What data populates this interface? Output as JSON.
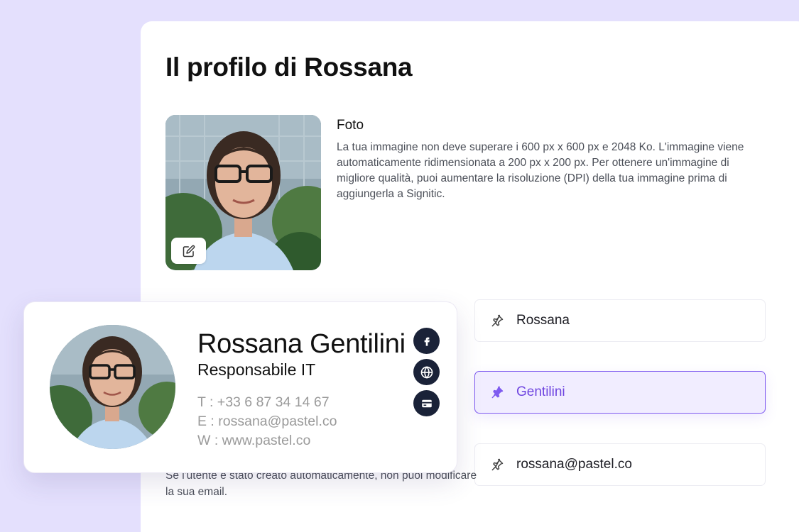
{
  "page": {
    "title": "Il profilo di Rossana"
  },
  "photo_section": {
    "label": "Foto",
    "description": "La tua immagine non deve superare i 600 px x 600 px e 2048 Ko. L'immagine viene automaticamente ridimensionata a 200 px x 200 px. Per ottenere un'immagine di migliore qualità, puoi aumentare la risoluzione (DPI) della tua immagine prima di aggiungerla a Signitic.",
    "edit_icon": "pencil-icon"
  },
  "fields": {
    "first_name": "Rossana",
    "last_name": "Gentilini",
    "email": "rossana@pastel.co",
    "icon": "pin-icon"
  },
  "email_note": "Se l'utente è stato creato automaticamente, non puoi modificare la sua email.",
  "signature": {
    "name": "Rossana Gentilini",
    "role": "Responsabile IT",
    "phone": "T : +33 6 87 34 14 67",
    "email": "E : rossana@pastel.co",
    "website": "W : www.pastel.co",
    "social_icons": [
      "facebook-icon",
      "globe-icon",
      "card-icon"
    ]
  },
  "colors": {
    "background": "#e4e0fd",
    "accent": "#7f5bf0",
    "active_field_bg": "#f1edff",
    "social_badge": "#1a2238"
  }
}
